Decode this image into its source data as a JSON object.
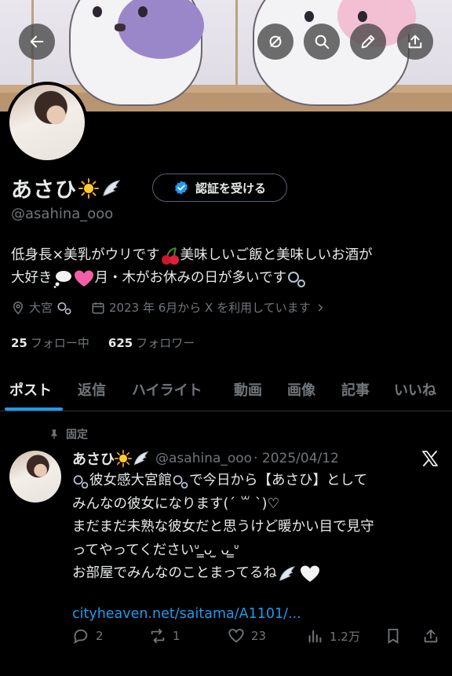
{
  "header": {
    "back_icon": "arrow-left-icon",
    "actions": [
      "eye-off-icon",
      "search-icon",
      "edit-pencil-icon",
      "share-upload-icon"
    ]
  },
  "profile": {
    "display_name": "あさひ",
    "name_emojis": [
      "sun-emoji",
      "wing-emoji"
    ],
    "verify_label": "認証を受ける",
    "handle": "@asahina_ooo",
    "bio": {
      "line1_a": "低身長×美乳がウリです",
      "line1_b": "美味しいご飯と美味しいお酒が",
      "line2_a": "大好き",
      "line2_b": "月・木がお休みの日が多いです"
    },
    "location": "大宮",
    "joined": "2023 年 6月から X を利用しています",
    "following_count": "25",
    "following_label": "フォロー中",
    "followers_count": "625",
    "followers_label": "フォロワー"
  },
  "tabs": [
    "ポスト",
    "返信",
    "ハイライト",
    "動画",
    "画像",
    "記事",
    "いいね"
  ],
  "active_tab": "ポスト",
  "post": {
    "pinned_label": "固定",
    "author_name": "あさひ",
    "author_handle": "@asahina_ooo",
    "date": "· 2025/04/12",
    "lines": [
      "彼女感大宮館",
      "で今日から【あさひ】として",
      "みんなの彼女になります(ˊ ꒳ ˋ)♡",
      "まだまだ未熟な彼女だと思うけど暖かい目で見守",
      "ってやってくださいᐡ ̳ᴗ ̫ ᴗ ̳ᐡ",
      "お部屋でみんなのことまってるね"
    ],
    "link": "cityheaven.net/saitama/A1101/...",
    "replies": "2",
    "reposts": "1",
    "likes": "23",
    "views": "1.2万"
  },
  "colors": {
    "background": "#000000",
    "text_primary": "#e7e9ea",
    "text_secondary": "#71767b",
    "accent": "#1d9bf0",
    "verified_badge": "#1d9bf0"
  }
}
